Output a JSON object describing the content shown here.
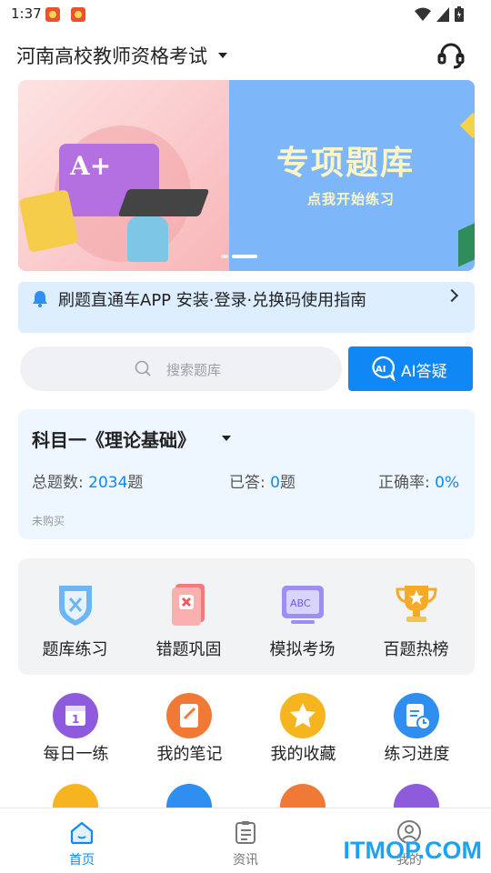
{
  "status_bar": {
    "time": "1:37"
  },
  "header": {
    "exam_title": "河南高校教师资格考试",
    "support_icon": "headset-icon"
  },
  "banner": {
    "title": "专项题库",
    "subtitle": "点我开始练习",
    "illustration_text": "A+",
    "pages": 2,
    "active_page": 1
  },
  "notice": {
    "text": "刷题直通车APP 安装·登录·兑换码使用指南"
  },
  "search": {
    "placeholder": "搜索题库",
    "ai_button": "AI答疑"
  },
  "subject": {
    "title": "科目一《理论基础》",
    "total_label": "总题数: ",
    "total_value": "2034",
    "total_unit": "题",
    "done_label": "已答: ",
    "done_value": "0",
    "done_unit": "题",
    "rate_label": "正确率: ",
    "rate_value": "0",
    "rate_unit": "%",
    "status": "未购买"
  },
  "features": [
    {
      "label": "题库练习",
      "icon": "shield-icon",
      "color": "#4aa3ef"
    },
    {
      "label": "错题巩固",
      "icon": "error-book-icon",
      "color": "#ef5a5a"
    },
    {
      "label": "模拟考场",
      "icon": "abc-screen-icon",
      "color": "#8a7cf0"
    },
    {
      "label": "百题热榜",
      "icon": "trophy-icon",
      "color": "#f5a623"
    }
  ],
  "tools": [
    {
      "label": "每日一练",
      "icon": "calendar-icon",
      "color": "#8e5bdc"
    },
    {
      "label": "我的笔记",
      "icon": "notebook-icon",
      "color": "#f07a35"
    },
    {
      "label": "我的收藏",
      "icon": "star-icon",
      "color": "#f6b51e"
    },
    {
      "label": "练习进度",
      "icon": "progress-doc-icon",
      "color": "#2e8ff0"
    }
  ],
  "tools_row2_colors": [
    "#f6b51e",
    "#2e8ff0",
    "#f07a35",
    "#8e5bdc"
  ],
  "nav": [
    {
      "label": "首页",
      "icon": "home-icon",
      "active": true
    },
    {
      "label": "资讯",
      "icon": "clipboard-icon",
      "active": false
    },
    {
      "label": "我的",
      "icon": "user-icon",
      "active": false
    }
  ],
  "watermark": "ITMOP.COM"
}
